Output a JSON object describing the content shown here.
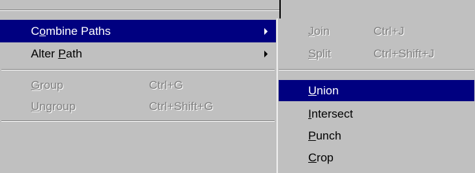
{
  "main_menu": {
    "items": [
      {
        "pre": "C",
        "key": "o",
        "post": "mbine Paths",
        "shortcut": "",
        "submenu": true,
        "selected": true,
        "disabled": false
      },
      {
        "pre": "Alter ",
        "key": "P",
        "post": "ath",
        "shortcut": "",
        "submenu": true,
        "selected": false,
        "disabled": false
      },
      {
        "pre": "",
        "key": "G",
        "post": "roup",
        "shortcut": "Ctrl+G",
        "submenu": false,
        "selected": false,
        "disabled": true
      },
      {
        "pre": "",
        "key": "U",
        "post": "ngroup",
        "shortcut": "Ctrl+Shift+G",
        "submenu": false,
        "selected": false,
        "disabled": true
      }
    ]
  },
  "sub_menu": {
    "items": [
      {
        "pre": "",
        "key": "J",
        "post": "oin",
        "shortcut": "Ctrl+J",
        "selected": false,
        "disabled": true
      },
      {
        "pre": "",
        "key": "S",
        "post": "plit",
        "shortcut": "Ctrl+Shift+J",
        "selected": false,
        "disabled": true
      },
      {
        "pre": "",
        "key": "U",
        "post": "nion",
        "shortcut": "",
        "selected": true,
        "disabled": false
      },
      {
        "pre": "",
        "key": "I",
        "post": "ntersect",
        "shortcut": "",
        "selected": false,
        "disabled": false
      },
      {
        "pre": "",
        "key": "P",
        "post": "unch",
        "shortcut": "",
        "selected": false,
        "disabled": false
      },
      {
        "pre": "",
        "key": "C",
        "post": "rop",
        "shortcut": "",
        "selected": false,
        "disabled": false
      }
    ]
  },
  "colors": {
    "menu_background": "#c0c0c0",
    "highlight": "#000080",
    "highlight_text": "#ffffff",
    "disabled_text": "#808080"
  }
}
